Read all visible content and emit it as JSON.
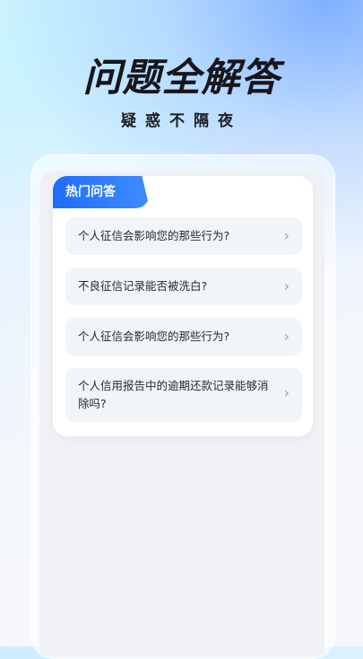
{
  "hero": {
    "title": "问题全解答",
    "subtitle": "疑惑不隔夜"
  },
  "hot_questions": {
    "tab_label": "热门问答",
    "items": [
      {
        "text": "个人征信会影响您的那些行为?"
      },
      {
        "text": "不良征信记录能否被洗白?"
      },
      {
        "text": "个人征信会影响您的那些行为?"
      },
      {
        "text": "个人信用报告中的逾期还款记录能够消除吗?"
      }
    ],
    "chevron": "›"
  },
  "colors": {
    "accent": "#1f6bff",
    "title": "#16161c",
    "item_bg": "#f1f4f9"
  }
}
